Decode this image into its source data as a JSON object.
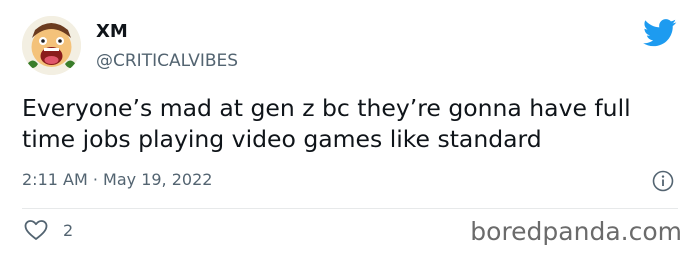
{
  "tweet": {
    "display_name": "XM",
    "handle": "@CRITICALVIBES",
    "text": "Everyone’s mad at gen z bc they’re gonna have full time jobs playing video games like standard",
    "timestamp": "2:11 AM · May 19, 2022",
    "like_count": "2"
  },
  "icons": {
    "brand": "twitter-bird-icon",
    "info": "info-icon",
    "like": "heart-outline-icon"
  },
  "colors": {
    "twitter_blue": "#1d9bf0",
    "secondary_text": "#536471",
    "primary_text": "#0f1419"
  },
  "watermark": "boredpanda.com"
}
